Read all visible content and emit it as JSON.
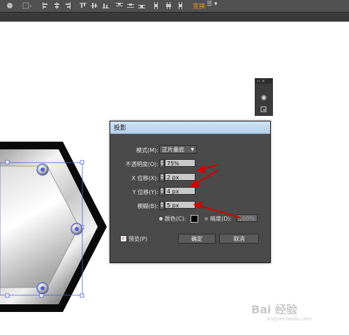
{
  "toolbar": {
    "active_label": "变换",
    "menu_glyph": "☰ ▾",
    "icons": [
      "globe-icon",
      "grid-select-icon",
      "align-left-icon",
      "align-center-h-icon",
      "align-right-icon",
      "align-top-icon",
      "align-center-v-icon",
      "align-bottom-icon",
      "distribute-top-icon",
      "distribute-center-v-icon",
      "distribute-bottom-icon",
      "distribute-left-icon",
      "distribute-center-h-icon",
      "distribute-right-icon"
    ]
  },
  "mini_panel": {
    "title": "›› ×"
  },
  "dialog": {
    "title": "投影",
    "mode": {
      "label": "模式(M):",
      "value": "正片叠底"
    },
    "opacity": {
      "label": "不透明度(O):",
      "value": "75%"
    },
    "x_offset": {
      "label": "X 位移(X):",
      "value": "2 px"
    },
    "y_offset": {
      "label": "Y 位移(Y):",
      "value": "4 px"
    },
    "blur": {
      "label": "模糊(B):",
      "value": "5 px"
    },
    "color_label": "颜色(C):",
    "darkness": {
      "label": "暗度(D):",
      "value": "100%"
    },
    "preview_label": "预览(P)",
    "ok_label": "确定",
    "cancel_label": "取消"
  },
  "watermark": {
    "text": "Bai 经验",
    "url": "jingyan.baidu.com"
  },
  "colors": {
    "accent": "#e8912a",
    "arrow": "#d40000",
    "selection": "#4f5fd6"
  }
}
